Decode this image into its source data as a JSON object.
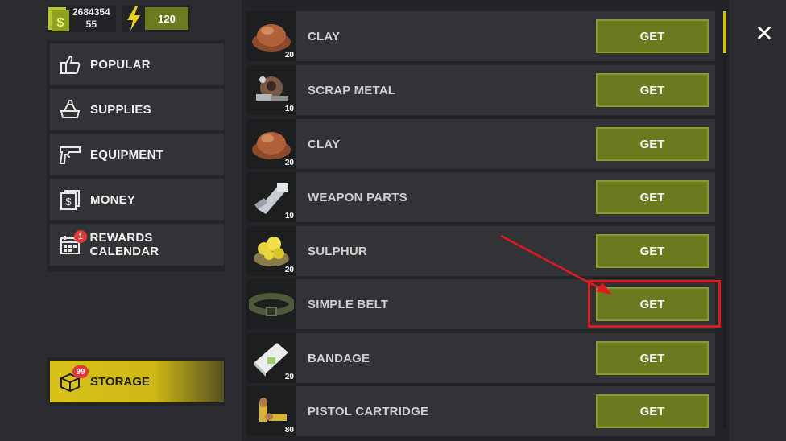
{
  "header": {
    "money_primary": "2684354",
    "money_secondary": "55",
    "energy": "120"
  },
  "menu": {
    "items": [
      {
        "label": "POPULAR",
        "icon": "thumbs-up-icon"
      },
      {
        "label": "SUPPLIES",
        "icon": "supplies-icon"
      },
      {
        "label": "EQUIPMENT",
        "icon": "pistol-icon"
      },
      {
        "label": "MONEY",
        "icon": "money-icon"
      },
      {
        "label": "REWARDS CALENDAR",
        "icon": "calendar-icon",
        "badge": "1"
      }
    ]
  },
  "storage": {
    "label": "STORAGE",
    "badge": "99",
    "icon": "box-icon"
  },
  "items": [
    {
      "name": "CLAY",
      "qty": "20",
      "button": "GET"
    },
    {
      "name": "SCRAP METAL",
      "qty": "10",
      "button": "GET"
    },
    {
      "name": "CLAY",
      "qty": "20",
      "button": "GET"
    },
    {
      "name": "WEAPON PARTS",
      "qty": "10",
      "button": "GET"
    },
    {
      "name": "SULPHUR",
      "qty": "20",
      "button": "GET"
    },
    {
      "name": "SIMPLE BELT",
      "qty": "",
      "button": "GET"
    },
    {
      "name": "BANDAGE",
      "qty": "20",
      "button": "GET"
    },
    {
      "name": "PISTOL CARTRIDGE",
      "qty": "80",
      "button": "GET"
    }
  ],
  "close": {
    "icon": "close-icon",
    "label": "✕"
  },
  "colors": {
    "accent": "#6c7a1f",
    "storage": "#d2bd19",
    "highlight": "#e0191c"
  }
}
